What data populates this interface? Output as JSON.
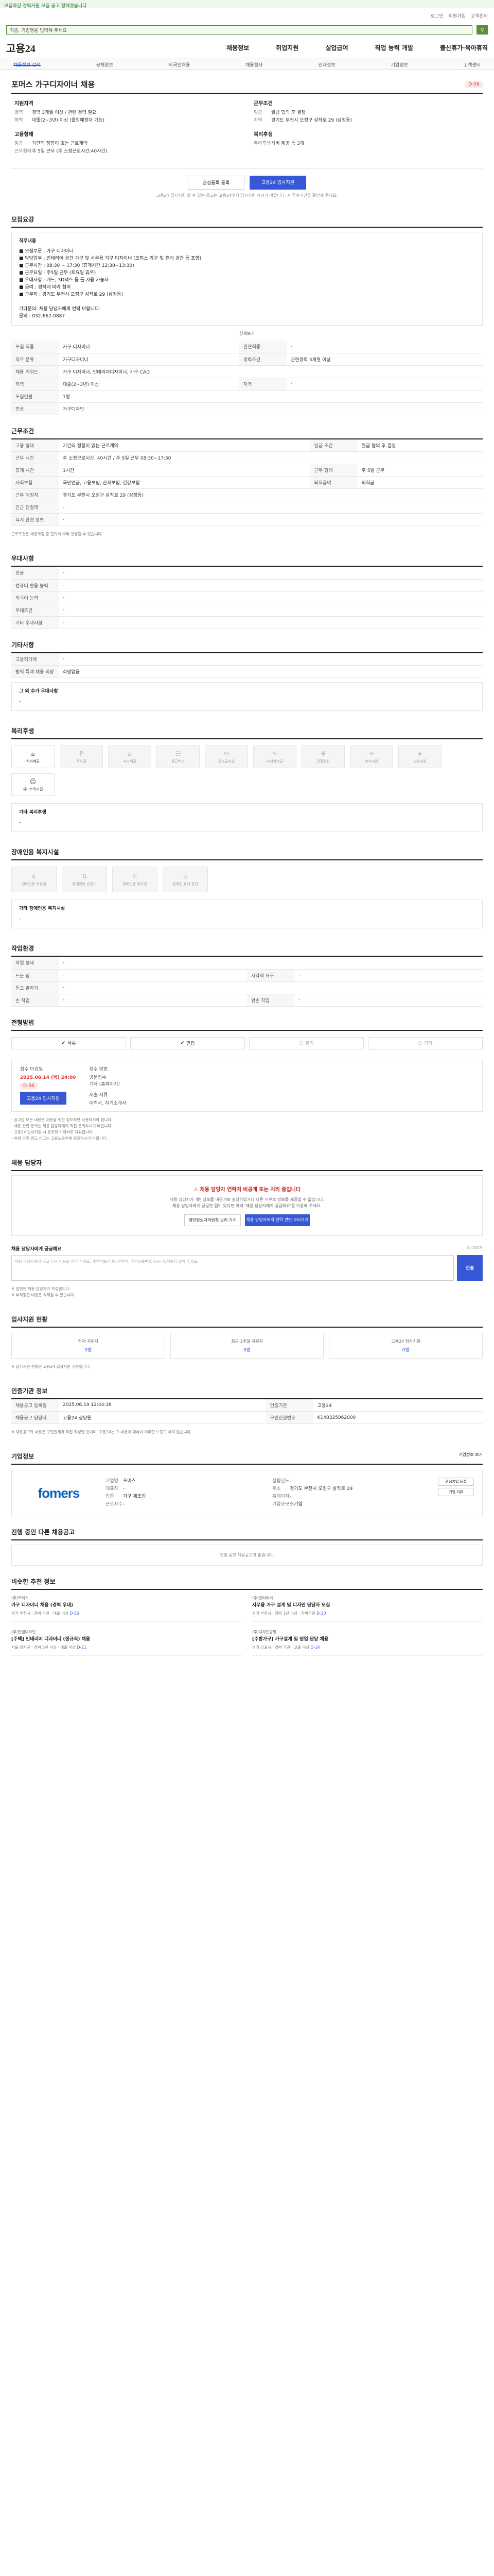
{
  "banner": "모집마감 경력사원 모집 공고 정해졌습니다",
  "top_tools": [
    "로그인",
    "회원가입",
    "고객센터"
  ],
  "search": {
    "placeholder": "직종, 기업명을 입력해 주세요"
  },
  "brand": {
    "logo": "고용24"
  },
  "gnb": [
    "채용정보",
    "취업지원",
    "실업급여",
    "직업 능력 개발",
    "출산휴가·육아휴직"
  ],
  "subnav": [
    "채용정보 검색",
    "공채정보",
    "외국인채용",
    "채용행사",
    "인재정보",
    "기업정보",
    "고객센터"
  ],
  "job": {
    "title": "포머스 가구디자이너 채용",
    "dday": "D-56",
    "summary_left": [
      {
        "h": "지원자격",
        "rows": [
          [
            "경력",
            "경력 3개월 이상 / 관련 경력 필요"
          ],
          [
            "학력",
            "대졸(2~3년) 이상 (졸업예정자 가능)"
          ]
        ]
      },
      {
        "h": "고용형태",
        "rows": [
          [
            "임금",
            "기간의 정함이 없는 근로계약"
          ],
          [
            "근무형태",
            "주 5일 근무 (주 소정근로시간:40시간)"
          ]
        ]
      }
    ],
    "summary_right": [
      {
        "h": "근무조건",
        "rows": [
          [
            "임금",
            "월급 협의 후 결정"
          ],
          [
            "지역",
            "경기도 부천시 오정구 삼작로 29 (삼정동)"
          ]
        ]
      },
      {
        "h": "복리후생",
        "rows": [
          [
            "복리후생",
            "식비 제공 등 3개"
          ]
        ]
      }
    ],
    "btn_interest": "관심등록 등록",
    "btn_apply": "고용24 입사지원",
    "note": "고용24 입사지원 할 수 있는 공고는 고용24에서 입사지원 하시기 바랍니다. ※ 접수기간을 확인해 주세요."
  },
  "detail": {
    "heading": "모집요강",
    "job_desc_title": "직무내용",
    "job_desc": [
      "■ 모집부문 : 가구 디자이너",
      "■ 담당업무 : 인테리어 공간 가구 및 사무용 가구 디자이너 (오피스 가구 및 휴게 공간 등 포함)",
      "■ 근무시간 : 08:30 ~ 17:30 (휴게시간 12:30~13:30)",
      "■ 근무요일 : 주5일 근무 (토요일 휴무)",
      "■ 우대사항 : 캐드, 3D맥스 등 툴 사용 가능자",
      "■ 급여 : 경력에 따라 협의",
      "■ 근무지 : 경기도 부천시 오정구 삼작로 29 (삼정동)",
      "",
      "기타문의: 채용 담당자에게 연락 바랍니다.",
      "문의 : 032-667-0887"
    ],
    "more": "상세보기",
    "rows": [
      [
        "모집 직종",
        "가구 디자이너",
        "관련직종",
        "-"
      ],
      [
        "직무 분류",
        "가구디자이너",
        "경력조건",
        "관련경력 3개월 이상"
      ],
      [
        "채용 키워드",
        "가구 디자이너, 인테리어디자이너, 가구 CAD",
        "",
        ""
      ],
      [
        "학력",
        "대졸(2~3년) 이상",
        "자격",
        "-"
      ],
      [
        "모집인원",
        "1명",
        "",
        ""
      ],
      [
        "전공",
        "가구디자인",
        "",
        ""
      ]
    ]
  },
  "work": {
    "heading": "근무조건",
    "rows": [
      [
        "고용 형태",
        "기간의 정함이 없는 근로계약",
        "임금 조건",
        "월급 협의 후 결정"
      ],
      [
        "근무 시간",
        "주 소정근로시간: 40시간 / 주 5일 근무 08:30~17:30",
        "",
        ""
      ],
      [
        "휴게 시간",
        "1시간",
        "근무 형태",
        "주 5일 근무"
      ],
      [
        "사회보험",
        "국민연금, 고용보험, 산재보험, 건강보험",
        "퇴직급여",
        "퇴직금"
      ],
      [
        "근무 예정지",
        "경기도 부천시 오정구 삼작로 29 (삼정동)",
        "",
        ""
      ],
      [
        "인근 전철역",
        "-",
        "",
        ""
      ],
      [
        "복지 관련 정보",
        "-",
        "",
        ""
      ]
    ],
    "note": "근로조건은 채용과정 중 협의에 따라 변경될 수 있습니다."
  },
  "prefer": {
    "heading": "우대사항",
    "rows": [
      [
        "전공",
        "-"
      ],
      [
        "컴퓨터 활용 능력",
        "-"
      ],
      [
        "외국어 능력",
        "-"
      ],
      [
        "우대조건",
        "-"
      ],
      [
        "기타 우대사항",
        "-"
      ]
    ]
  },
  "etc": {
    "heading": "기타사항",
    "rows": [
      [
        "고용허가제",
        "-"
      ],
      [
        "병역 특례 채용 희망",
        "희망없음"
      ]
    ],
    "more_title": "그 외 추가 우대사항",
    "more_val": "-"
  },
  "welfare": {
    "heading": "복리후생",
    "cards": [
      {
        "label": "식비제공",
        "on": true,
        "icon": "meal-icon"
      },
      {
        "label": "주차장",
        "on": false,
        "icon": "parking-icon"
      },
      {
        "label": "숙소제공",
        "on": false,
        "icon": "housing-icon"
      },
      {
        "label": "통근버스",
        "on": false,
        "icon": "bus-icon"
      },
      {
        "label": "경조금지원",
        "on": false,
        "icon": "gift-icon"
      },
      {
        "label": "자녀학자금",
        "on": false,
        "icon": "school-icon"
      },
      {
        "label": "건강검진",
        "on": false,
        "icon": "health-icon"
      },
      {
        "label": "휴가지원",
        "on": false,
        "icon": "vacation-icon"
      },
      {
        "label": "교육지원",
        "on": false,
        "icon": "education-icon"
      },
      {
        "label": "자녀보육지원",
        "on": true,
        "icon": "child-icon"
      }
    ],
    "etc_title": "기타 복리후생",
    "etc_val": "-"
  },
  "disability": {
    "heading": "장애인용 복지시설",
    "cards": [
      "장애인용 화장실",
      "장애인용 승강기",
      "장애인용 주차장",
      "장애인 휴게 공간"
    ],
    "etc_title": "기타 장애인용 복지시설",
    "etc_val": "-"
  },
  "env": {
    "heading": "작업환경",
    "rows": [
      [
        "작업 형태",
        "-",
        "",
        ""
      ],
      [
        "드는 힘",
        "-",
        "시각적 요구",
        "-"
      ],
      [
        "듣고 말하기",
        "-",
        "",
        ""
      ],
      [
        "손 작업",
        "-",
        "양손 작업",
        "-"
      ]
    ]
  },
  "process": {
    "heading": "전형방법",
    "methods": [
      {
        "label": "서류",
        "on": true
      },
      {
        "label": "면접",
        "on": true
      },
      {
        "label": "필기",
        "on": false
      },
      {
        "label": "기타",
        "on": false
      }
    ],
    "apply_title": "접수 마감일",
    "apply_date": "2025.08.14 (목) 24:00",
    "apply_dday": "D-56",
    "apply_btn": "고용24 입사지원",
    "method_title": "접수 방법",
    "method_vals": [
      "방문접수",
      "기타 (홈페이지)"
    ],
    "docs_title": "제출 서류",
    "docs_val": "이력서, 자기소개서",
    "notes": [
      "- 공고상 모든 내용은 채용을 위한 정보로만 사용하셔야 합니다.",
      "- 채용 관련 문의는 채용 담당자에게 직접 문의하시기 바랍니다.",
      "- 고용24 입사지원 시 등록된 이력서로 지원됩니다.",
      "- 허위 구인 광고 신고는 고용노동부에 문의하시기 바랍니다."
    ]
  },
  "manager": {
    "heading": "채용 담당자",
    "warn": "채용 담당자 연락처 비공개 또는 처리 중입니다",
    "txt1": "채용 담당자가 개인정보를 비공개로 설정하였거나 다른 이유로 정보를 제공할 수 없습니다.",
    "txt2": "채용 담당자에게 궁금한 점이 있다면 아래 '채용 담당자에게 궁금해요'를 이용해 주세요.",
    "btn1": "개인정보처리방침 보러 가기",
    "btn2": "채용 담당자에게 연락 관련 보러가기",
    "qa_label": "채용 담당자에게 궁금해요",
    "qa_right": "0 / 500자",
    "qa_placeholder": "채용 담당자에게 묻고 싶은 내용을 적어 주세요. 개인정보(이름, 연락처, 주민등록번호 등)는 입력하지 말아 주세요.",
    "qa_btn": "전송",
    "qa_notes": [
      "※ 답변은 채용 담당자가 작성합니다.",
      "※ 부적절한 내용은 삭제될 수 있습니다."
    ]
  },
  "status": {
    "heading": "입사지원 현황",
    "cards": [
      {
        "label": "전체 지원자",
        "n": "0명"
      },
      {
        "label": "최근 1주일 지원자",
        "n": "0명"
      },
      {
        "label": "고용24 입사지원",
        "n": "0명"
      }
    ],
    "note": "※ 입사지원 현황은 고용24 입사지원 기준입니다."
  },
  "recruit": {
    "heading": "인증기관 정보",
    "rows": [
      [
        "채용공고 등록일",
        "2025.06.19 12:44:36",
        "인증기관",
        "고용24"
      ],
      [
        "채용공고 담당자",
        "고용24 상담원",
        "구인신청번호",
        "K140325062000"
      ]
    ],
    "notes": "※ 채용공고의 내용은 구인업체가 직접 작성한 것이며, 고용24는 그 내용에 대하여 어떠한 보증도 하지 않습니다."
  },
  "company": {
    "heading": "기업정보",
    "more": "기업정보 보기",
    "logo": "fomers",
    "cols": [
      [
        [
          "기업명",
          "포머스"
        ],
        [
          "대표자",
          "-"
        ],
        [
          "업종",
          "가구 제조업"
        ],
        [
          "근로자수",
          "-"
        ]
      ],
      [
        [
          "설립년도",
          "-"
        ],
        [
          "주소",
          "경기도 부천시 오정구 삼작로 29"
        ],
        [
          "홈페이지",
          "-"
        ],
        [
          "기업규모",
          "소기업"
        ]
      ]
    ],
    "side": [
      "관심기업 등록",
      "기업 리뷰"
    ]
  },
  "other": {
    "heading": "진행 중인 다른 채용공고",
    "empty": "진행 중인 채용공고가 없습니다."
  },
  "recs": {
    "heading": "비슷한 추천 정보",
    "items": [
      {
        "co": "(주)포머스",
        "ttl": "가구 디자이너 채용 (경력 우대)",
        "meta": "경기 부천시 · 경력 무관 · 대졸 이상",
        "d": "D-56"
      },
      {
        "co": "(주)인터리어",
        "ttl": "사무용 가구 설계 및 디자인 담당자 모집",
        "meta": "경기 부천시 · 경력 1년 이상 · 학력무관",
        "d": "D-30"
      },
      {
        "co": "(주)한샘디자인",
        "ttl": "[주택] 인테리어 디자이너 (정규직) 채용",
        "meta": "서울 강서구 · 경력 3년 이상 · 대졸 이상",
        "d": "D-21"
      },
      {
        "co": "(주)디자인공방",
        "ttl": "[주방가구] 가구설계 및 영업 담당 채용",
        "meta": "경기 김포시 · 경력 무관 · 고졸 이상",
        "d": "D-14"
      }
    ]
  }
}
